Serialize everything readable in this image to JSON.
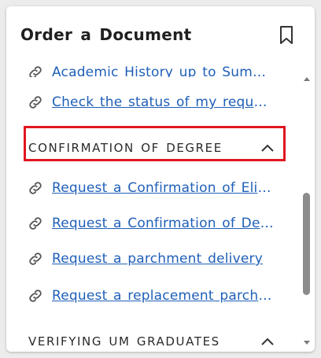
{
  "panel": {
    "title": "Order a Document"
  },
  "links_top": [
    {
      "label": "Academic History up to Summe..."
    },
    {
      "label": "Check the status of my request..."
    }
  ],
  "sections": [
    {
      "heading": "CONFIRMATION OF DEGREE",
      "links": [
        {
          "label": "Request a Confirmation of Eligi..."
        },
        {
          "label": "Request a Confirmation of Deg..."
        },
        {
          "label": "Request a parchment delivery"
        },
        {
          "label": "Request a replacement parchm..."
        }
      ]
    },
    {
      "heading": "VERIFYING UM GRADUATES"
    }
  ],
  "icons": {
    "bookmark": "bookmark-icon",
    "link": "link-icon",
    "chevron": "chevron-up-icon"
  },
  "colors": {
    "link": "#1f5fb8",
    "highlight": "#e0161f"
  }
}
